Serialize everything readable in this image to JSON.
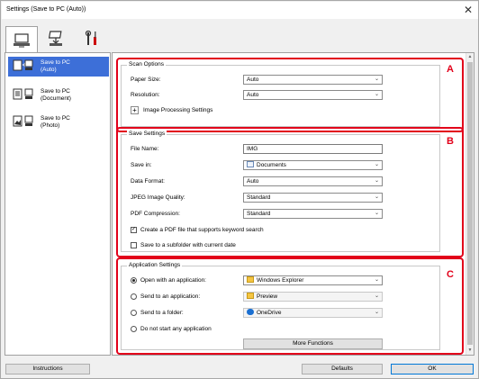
{
  "window": {
    "title": "Settings (Save to PC (Auto))",
    "close": "✕"
  },
  "tabs": [
    {
      "icon": "computer-scan-icon"
    },
    {
      "icon": "device-scan-icon"
    },
    {
      "icon": "tools-icon"
    }
  ],
  "left_panel": {
    "items": [
      {
        "label_line1": "Save to PC",
        "label_line2": "(Auto)",
        "selected": true
      },
      {
        "label_line1": "Save to PC",
        "label_line2": "(Document)",
        "selected": false
      },
      {
        "label_line1": "Save to PC",
        "label_line2": "(Photo)",
        "selected": false
      }
    ]
  },
  "scan_options": {
    "title": "Scan Options",
    "badge": "A",
    "paper_size_label": "Paper Size:",
    "paper_size_value": "Auto",
    "resolution_label": "Resolution:",
    "resolution_value": "Auto",
    "image_processing_label": "Image Processing Settings",
    "expand": "+"
  },
  "save_settings": {
    "title": "Save Settings",
    "badge": "B",
    "file_name_label": "File Name:",
    "file_name_value": "IMG",
    "save_in_label": "Save in:",
    "save_in_value": "Documents",
    "data_format_label": "Data Format:",
    "data_format_value": "Auto",
    "jpeg_quality_label": "JPEG Image Quality:",
    "jpeg_quality_value": "Standard",
    "pdf_compression_label": "PDF Compression:",
    "pdf_compression_value": "Standard",
    "keyword_pdf_label": "Create a PDF file that supports keyword search",
    "keyword_pdf_checked": true,
    "subfolder_label": "Save to a subfolder with current date",
    "subfolder_checked": false
  },
  "app_settings": {
    "title": "Application Settings",
    "badge": "C",
    "open_app_label": "Open with an application:",
    "open_app_value": "Windows Explorer",
    "send_app_label": "Send to an application:",
    "send_app_value": "Preview",
    "send_folder_label": "Send to a folder:",
    "send_folder_value": "OneDrive",
    "no_app_label": "Do not start any application",
    "more_functions": "More Functions",
    "selected_option": "open_app"
  },
  "footer": {
    "instructions": "Instructions",
    "defaults": "Defaults",
    "ok": "OK"
  },
  "colors": {
    "accent_red": "#e2001a",
    "selected_blue": "#3d6fd8"
  }
}
